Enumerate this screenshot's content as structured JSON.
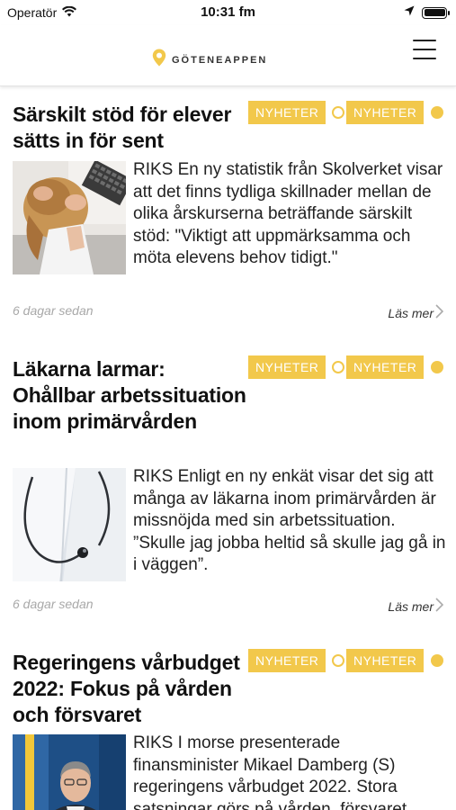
{
  "status_bar": {
    "carrier": "Operatör",
    "time": "10:31 fm"
  },
  "header": {
    "logo_text": "GÖTENEAPPEN"
  },
  "colors": {
    "accent": "#f2c84b"
  },
  "articles": [
    {
      "title": "Särskilt stöd för elever sätts in för sent",
      "tags": [
        "NYHETER",
        "NYHETER"
      ],
      "excerpt": "RIKS En ny statistik från Skolverket visar att det finns tydliga skillnader mellan de olika årskurserna beträffande särskilt stöd: \"Viktigt att uppmärksamma och möta elevens behov tidigt.\"",
      "time": "6 dagar sedan",
      "read_more": "Läs mer"
    },
    {
      "title": "Läkarna larmar: Ohållbar arbetssituation inom primärvården",
      "tags": [
        "NYHETER",
        "NYHETER"
      ],
      "excerpt": "RIKS Enligt en ny enkät visar det sig att många av läkarna inom primärvården är missnöjda med sin arbetssituation. ”Skulle jag jobba heltid så skulle jag gå in i väggen”.",
      "time": "6 dagar sedan",
      "read_more": "Läs mer"
    },
    {
      "title": "Regeringens vårbudget 2022: Fokus på vården och försvaret",
      "tags": [
        "NYHETER",
        "NYHETER"
      ],
      "excerpt": "RIKS I morse presenterade finansminister Mikael Damberg (S) regeringens vårbudget 2022. Stora satsningar görs på vården, försvaret"
    }
  ]
}
